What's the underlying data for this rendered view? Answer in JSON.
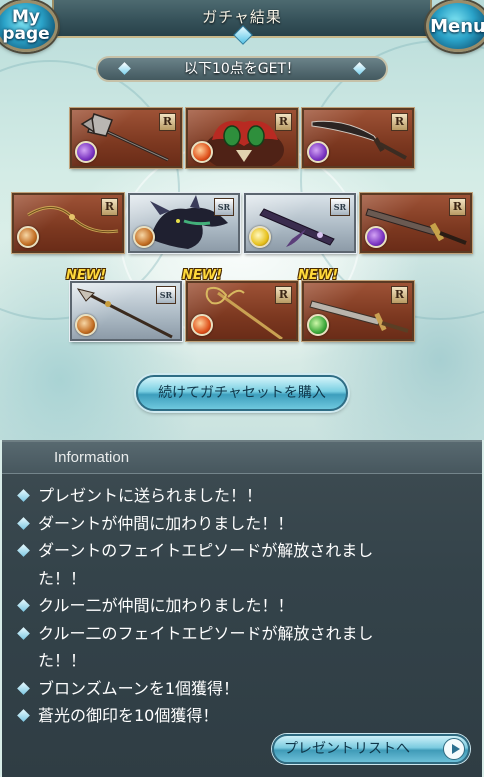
{
  "header": {
    "title": "ガチャ結果",
    "mypage_label_1": "My",
    "mypage_label_2": "page",
    "menu_label": "Menu"
  },
  "result": {
    "banner": "以下10点をGET！",
    "new_label": "NEW!",
    "cards": [
      {
        "rarity": "R",
        "element": "dark",
        "icon": "axe-icon",
        "new": false
      },
      {
        "rarity": "R",
        "element": "fire",
        "icon": "monster-icon",
        "new": false
      },
      {
        "rarity": "R",
        "element": "dark",
        "icon": "sword-icon",
        "new": false
      },
      {
        "rarity": "R",
        "element": "earth",
        "icon": "bow-icon",
        "new": false
      },
      {
        "rarity": "SR",
        "element": "earth",
        "icon": "dragon-icon",
        "new": false
      },
      {
        "rarity": "SR",
        "element": "light",
        "icon": "gun-icon",
        "new": false
      },
      {
        "rarity": "R",
        "element": "dark",
        "icon": "sword-icon",
        "new": false
      },
      {
        "rarity": "SR",
        "element": "earth",
        "icon": "spear-icon",
        "new": true
      },
      {
        "rarity": "R",
        "element": "fire",
        "icon": "staff-icon",
        "new": true
      },
      {
        "rarity": "R",
        "element": "wind",
        "icon": "sword-icon",
        "new": true
      }
    ],
    "continue_button": "続けてガチャセットを購入"
  },
  "information": {
    "title": "Information",
    "items": [
      "プレゼントに送られました！！",
      "ダーントが仲間に加わりました！！",
      "ダーントのフェイトエピソードが解放されました！！",
      "クルー二が仲間に加わりました！！",
      "クルー二のフェイトエピソードが解放されました！！",
      "ブロンズムーンを1個獲得！",
      "蒼光の御印を10個獲得！"
    ],
    "present_button": "プレゼントリストへ"
  }
}
